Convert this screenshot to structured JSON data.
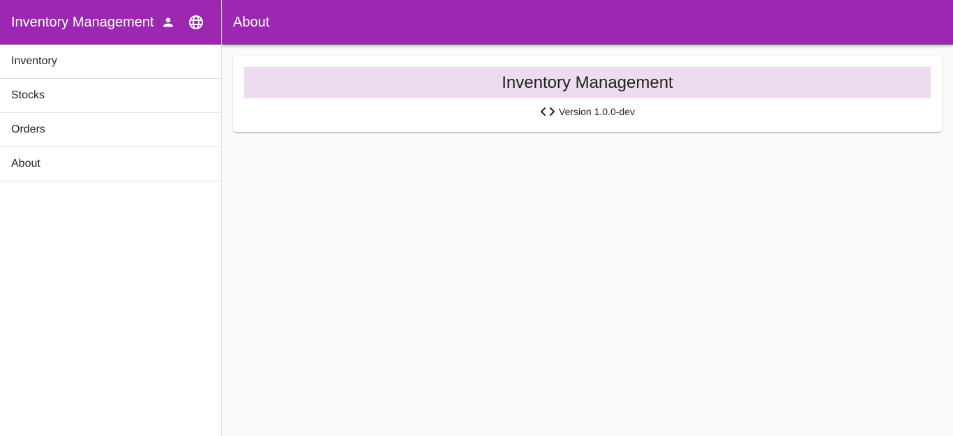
{
  "sidebar": {
    "app_title": "Inventory Management",
    "icons": {
      "user": "person-icon",
      "language": "globe-icon"
    },
    "items": [
      {
        "label": "Inventory"
      },
      {
        "label": "Stocks"
      },
      {
        "label": "Orders"
      },
      {
        "label": "About"
      }
    ]
  },
  "header": {
    "title": "About"
  },
  "about_card": {
    "title": "Inventory Management",
    "version": "Version 1.0.0-dev",
    "version_icon": "code-icon"
  },
  "colors": {
    "primary": "#9c27b0",
    "banner": "#eddcef",
    "background": "#fafafa"
  }
}
